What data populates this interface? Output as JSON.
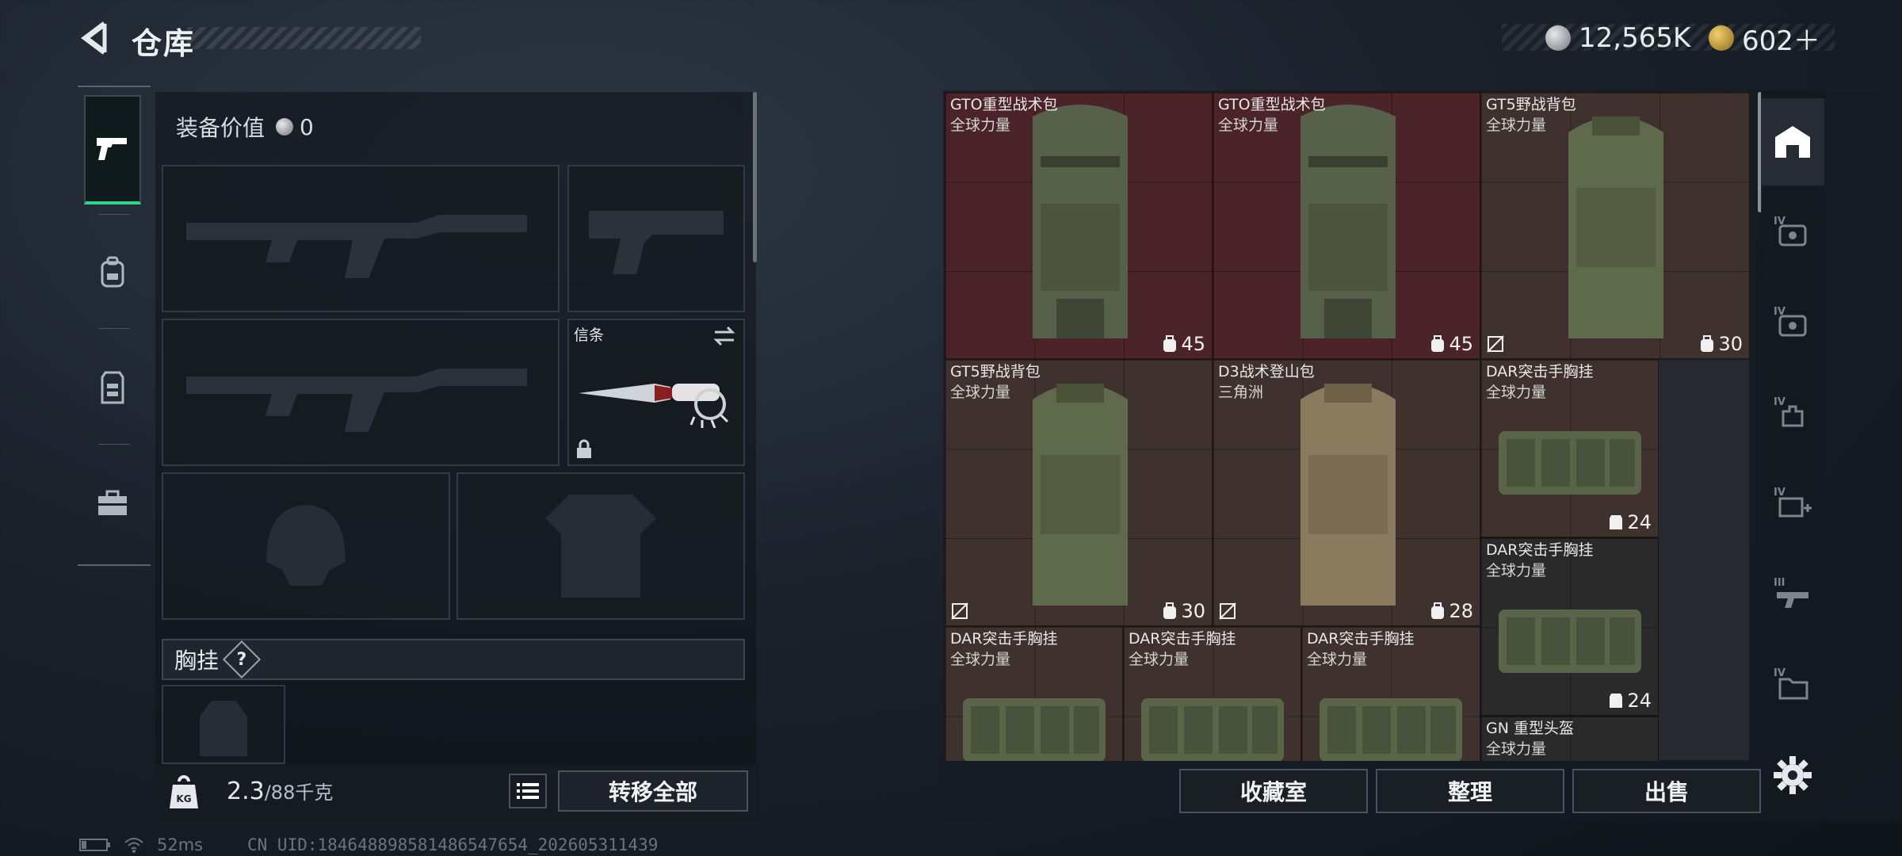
{
  "header": {
    "title": "仓库",
    "currency": [
      {
        "icon": "silver-coin-icon",
        "value": "12,565K"
      },
      {
        "icon": "gold-coin-icon",
        "value": "602＋"
      }
    ]
  },
  "sidebar": {
    "items": [
      {
        "icon": "pistol-icon",
        "active": true
      },
      {
        "icon": "backpack-icon",
        "active": false
      },
      {
        "icon": "vest-icon",
        "active": false
      },
      {
        "icon": "toolbox-icon",
        "active": false
      }
    ]
  },
  "equipment": {
    "value_label": "装备价值",
    "value": "0",
    "melee_label": "信条",
    "chest_label": "胸挂",
    "chest_hint": "?",
    "weight": "2.3",
    "weight_max": "/88千克",
    "transfer_all": "转移全部"
  },
  "inventory": {
    "items": [
      {
        "name": "GTO重型战术包",
        "sub": "全球力量",
        "cap": "45",
        "color": "red",
        "insurance_off": false
      },
      {
        "name": "GTO重型战术包",
        "sub": "全球力量",
        "cap": "45",
        "color": "red",
        "insurance_off": false
      },
      {
        "name": "GT5野战背包",
        "sub": "全球力量",
        "cap": "30",
        "color": "brown",
        "insurance_off": true
      },
      {
        "name": "GT5野战背包",
        "sub": "全球力量",
        "cap": "30",
        "color": "brown",
        "insurance_off": true
      },
      {
        "name": "D3战术登山包",
        "sub": "三角洲",
        "cap": "28",
        "color": "brown",
        "insurance_off": true
      },
      {
        "name": "DAR突击手胸挂",
        "sub": "全球力量",
        "cap": "24",
        "color": "brown",
        "insurance_off": false
      },
      {
        "name": "DAR突击手胸挂",
        "sub": "全球力量",
        "cap": "24",
        "color": "dark",
        "insurance_off": false
      },
      {
        "name": "DAR突击手胸挂",
        "sub": "全球力量",
        "cap": "",
        "color": "brown",
        "insurance_off": false
      },
      {
        "name": "DAR突击手胸挂",
        "sub": "全球力量",
        "cap": "",
        "color": "brown",
        "insurance_off": false
      },
      {
        "name": "DAR突击手胸挂",
        "sub": "全球力量",
        "cap": "",
        "color": "brown",
        "insurance_off": false
      },
      {
        "name": "GN 重型头盔",
        "sub": "全球力量",
        "cap": "",
        "color": "dark",
        "insurance_off": false
      }
    ]
  },
  "right_sidebar": {
    "tabs": [
      {
        "icon": "home-icon",
        "active": true
      },
      {
        "icon": "tier-iv-backpack-icon",
        "active": false
      },
      {
        "icon": "tier-iv-backpack-icon",
        "active": false
      },
      {
        "icon": "tier-iv-hand-icon",
        "active": false
      },
      {
        "icon": "tier-iv-medkit-icon",
        "active": false
      },
      {
        "icon": "tier-iii-gun-icon",
        "active": false
      },
      {
        "icon": "tier-iv-folder-icon",
        "active": false
      }
    ]
  },
  "actions": {
    "collection": "收藏室",
    "sort": "整理",
    "sell": "出售"
  },
  "status": {
    "ping": "52ms",
    "uid": "CN UID:1846488985814865476​54_202605311439"
  },
  "colors": {
    "accent_green": "#2fd38a",
    "item_red": "#4a2429",
    "item_brown": "#3f322e"
  }
}
